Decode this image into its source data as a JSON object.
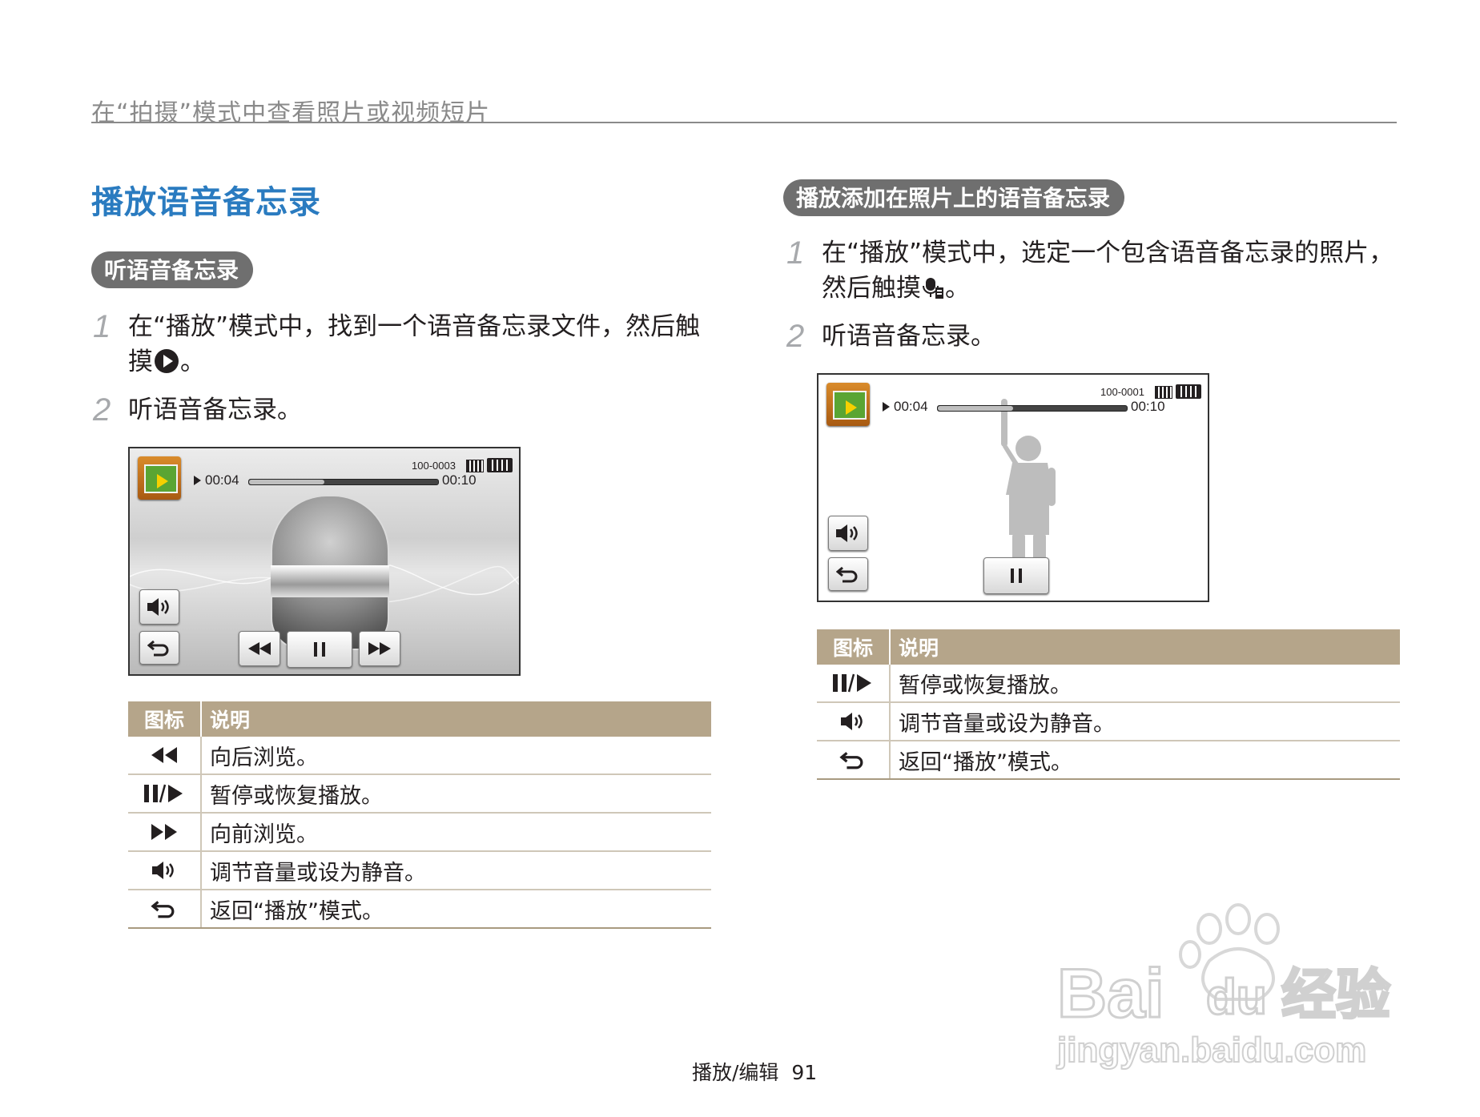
{
  "header": {
    "running_head": "在“拍摄”模式中查看照片或视频短片"
  },
  "left": {
    "section_title": "播放语音备忘录",
    "pill": "听语音备忘录",
    "steps": [
      {
        "num": "1",
        "line1": "在“播放”模式中，找到一个语音备忘录文件，然后触",
        "line2_pre": "摸",
        "line2_post": "。"
      },
      {
        "num": "2",
        "text": "听语音备忘录。"
      }
    ],
    "screen": {
      "file_no": "100-0003",
      "time_elapsed": "00:04",
      "time_total": "00:10",
      "progress": 0.4
    },
    "table": {
      "col_icon": "图标",
      "col_desc": "说明",
      "rows": [
        {
          "icon": "rewind-icon",
          "desc": "向后浏览。"
        },
        {
          "icon": "pause-play-icon",
          "desc": "暂停或恢复播放。"
        },
        {
          "icon": "fast-forward-icon",
          "desc": "向前浏览。"
        },
        {
          "icon": "volume-icon",
          "desc": "调节音量或设为静音。"
        },
        {
          "icon": "back-icon",
          "desc": "返回“播放”模式。"
        }
      ]
    }
  },
  "right": {
    "pill": "播放添加在照片上的语音备忘录",
    "steps": [
      {
        "num": "1",
        "line1": "在“播放”模式中，选定一个包含语音备忘录的照片，",
        "line2_pre": "然后触摸",
        "line2_post": "。"
      },
      {
        "num": "2",
        "text": "听语音备忘录。"
      }
    ],
    "screen": {
      "file_no": "100-0001",
      "time_elapsed": "00:04",
      "time_total": "00:10",
      "progress": 0.4
    },
    "table": {
      "col_icon": "图标",
      "col_desc": "说明",
      "rows": [
        {
          "icon": "pause-play-icon",
          "desc": "暂停或恢复播放。"
        },
        {
          "icon": "volume-icon",
          "desc": "调节音量或设为静音。"
        },
        {
          "icon": "back-icon",
          "desc": "返回“播放”模式。"
        }
      ]
    }
  },
  "footer": {
    "section": "播放/编辑",
    "page": "91"
  },
  "watermark": {
    "brand": "Bai",
    "brand2": "du",
    "brand_cn": "经验",
    "url": "jingyan.baidu.com"
  },
  "colors": {
    "title_blue": "#2a7bc0",
    "pill_gray": "#6f6f6f",
    "table_header": "#b5a58a"
  }
}
